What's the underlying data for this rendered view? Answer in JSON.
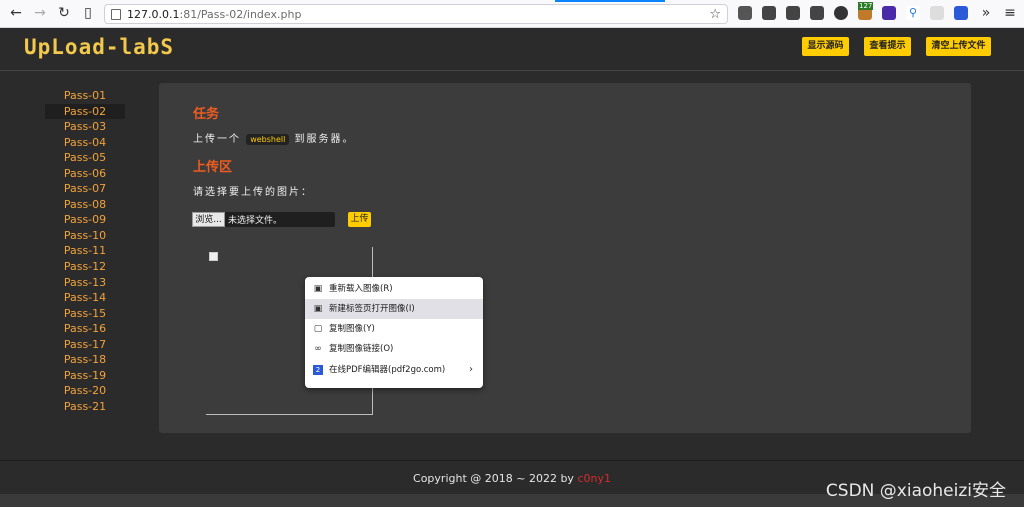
{
  "browser": {
    "url_host": "127.0.0.1",
    "url_path": ":81/Pass-02/index.php",
    "ext_badge": "127"
  },
  "header": {
    "logo": "UpLoad-labS",
    "buttons": [
      "显示源码",
      "查看提示",
      "清空上传文件"
    ]
  },
  "sidebar": {
    "items": [
      "Pass-01",
      "Pass-02",
      "Pass-03",
      "Pass-04",
      "Pass-05",
      "Pass-06",
      "Pass-07",
      "Pass-08",
      "Pass-09",
      "Pass-10",
      "Pass-11",
      "Pass-12",
      "Pass-13",
      "Pass-14",
      "Pass-15",
      "Pass-16",
      "Pass-17",
      "Pass-18",
      "Pass-19",
      "Pass-20",
      "Pass-21"
    ],
    "active_index": 1
  },
  "main": {
    "task_title": "任务",
    "task_prefix": "上传一个",
    "task_code": "webshell",
    "task_suffix": "到服务器。",
    "upload_title": "上传区",
    "choose_label": "请选择要上传的图片：",
    "browse_label": "浏览...",
    "no_file": "未选择文件。",
    "upload_button": "上传"
  },
  "context_menu": {
    "items": [
      {
        "label": "重新载入图像(R)",
        "icon": "reload-image-icon"
      },
      {
        "label": "新建标签页打开图像(I)",
        "icon": "open-image-icon"
      },
      {
        "label": "复制图像(Y)",
        "icon": "copy-image-icon"
      },
      {
        "label": "复制图像链接(O)",
        "icon": "link-icon"
      },
      {
        "label": "在线PDF编辑器(pdf2go.com)",
        "icon": "pdf2go-icon"
      }
    ],
    "hover_index": 1
  },
  "footer": {
    "copyright": "Copyright @ 2018 ~ 2022 by ",
    "author": "c0ny1"
  },
  "watermark": "CSDN @xiaoheizi安全",
  "colors": {
    "accent_yellow": "#ffcc00",
    "heading_orange": "#ee5c1f",
    "link_orange": "#f2a23c",
    "background": "#2b2b2b"
  }
}
